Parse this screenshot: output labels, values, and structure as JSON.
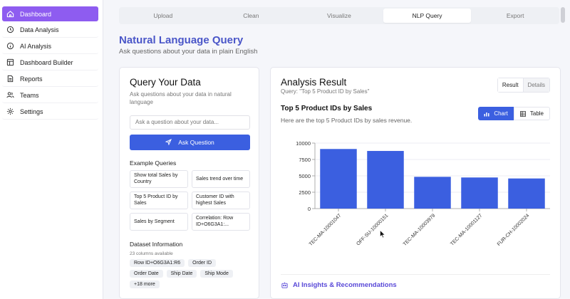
{
  "sidebar": {
    "items": [
      {
        "label": "Dashboard",
        "icon": "home-icon",
        "active": true
      },
      {
        "label": "Data Analysis",
        "icon": "clock-icon"
      },
      {
        "label": "AI Analysis",
        "icon": "info-icon"
      },
      {
        "label": "Dashboard Builder",
        "icon": "layout-icon"
      },
      {
        "label": "Reports",
        "icon": "document-icon"
      },
      {
        "label": "Teams",
        "icon": "users-icon"
      },
      {
        "label": "Settings",
        "icon": "gear-icon"
      }
    ]
  },
  "tabs": [
    {
      "label": "Upload"
    },
    {
      "label": "Clean"
    },
    {
      "label": "Visualize"
    },
    {
      "label": "NLP Query",
      "active": true
    },
    {
      "label": "Export"
    }
  ],
  "page": {
    "title": "Natural Language Query",
    "subtitle": "Ask questions about your data in plain English"
  },
  "query": {
    "title": "Query Your Data",
    "subtitle": "Ask questions about your data in natural language",
    "input_placeholder": "Ask a question about your data...",
    "ask_label": "Ask Question",
    "examples_label": "Example Queries",
    "examples": [
      "Show total Sales by Country",
      "Sales trend over time",
      "Top 5 Product ID by Sales",
      "Customer ID with highest Sales",
      "Sales by Segment",
      "Correlation: Row ID+O6G3A1:..."
    ],
    "dataset_label": "Dataset Information",
    "dataset_columns": "23 columns available",
    "chips": [
      "Row ID+O6G3A1:R6",
      "Order ID",
      "Order Date",
      "Ship Date",
      "Ship Mode",
      "+18 more"
    ]
  },
  "result": {
    "title": "Analysis Result",
    "query_line": "Query: \"Top 5 Product ID by Sales\"",
    "toggle_result": "Result",
    "toggle_details": "Details",
    "chart_title": "Top 5 Product IDs by Sales",
    "chart_subtitle": "Here are the top 5 Product IDs by sales revenue.",
    "view_chart": "Chart",
    "view_table": "Table",
    "insights_label": "AI Insights & Recommendations"
  },
  "colors": {
    "accent": "#3b5fe0",
    "active_nav": "#8e5cf0",
    "title": "#4a56c8"
  },
  "chart_data": {
    "type": "bar",
    "categories": [
      "TEC-MA-10001047",
      "OFF-SU-10000151",
      "TEC-MA-10003979",
      "TEC-MA-10001127",
      "FUR-CH-10002024"
    ],
    "values": [
      9100,
      8800,
      4850,
      4750,
      4600
    ],
    "ylim": [
      0,
      10000
    ],
    "yticks": [
      0,
      2500,
      5000,
      7500,
      10000
    ],
    "color": "#3b5fe0",
    "grid": true
  }
}
